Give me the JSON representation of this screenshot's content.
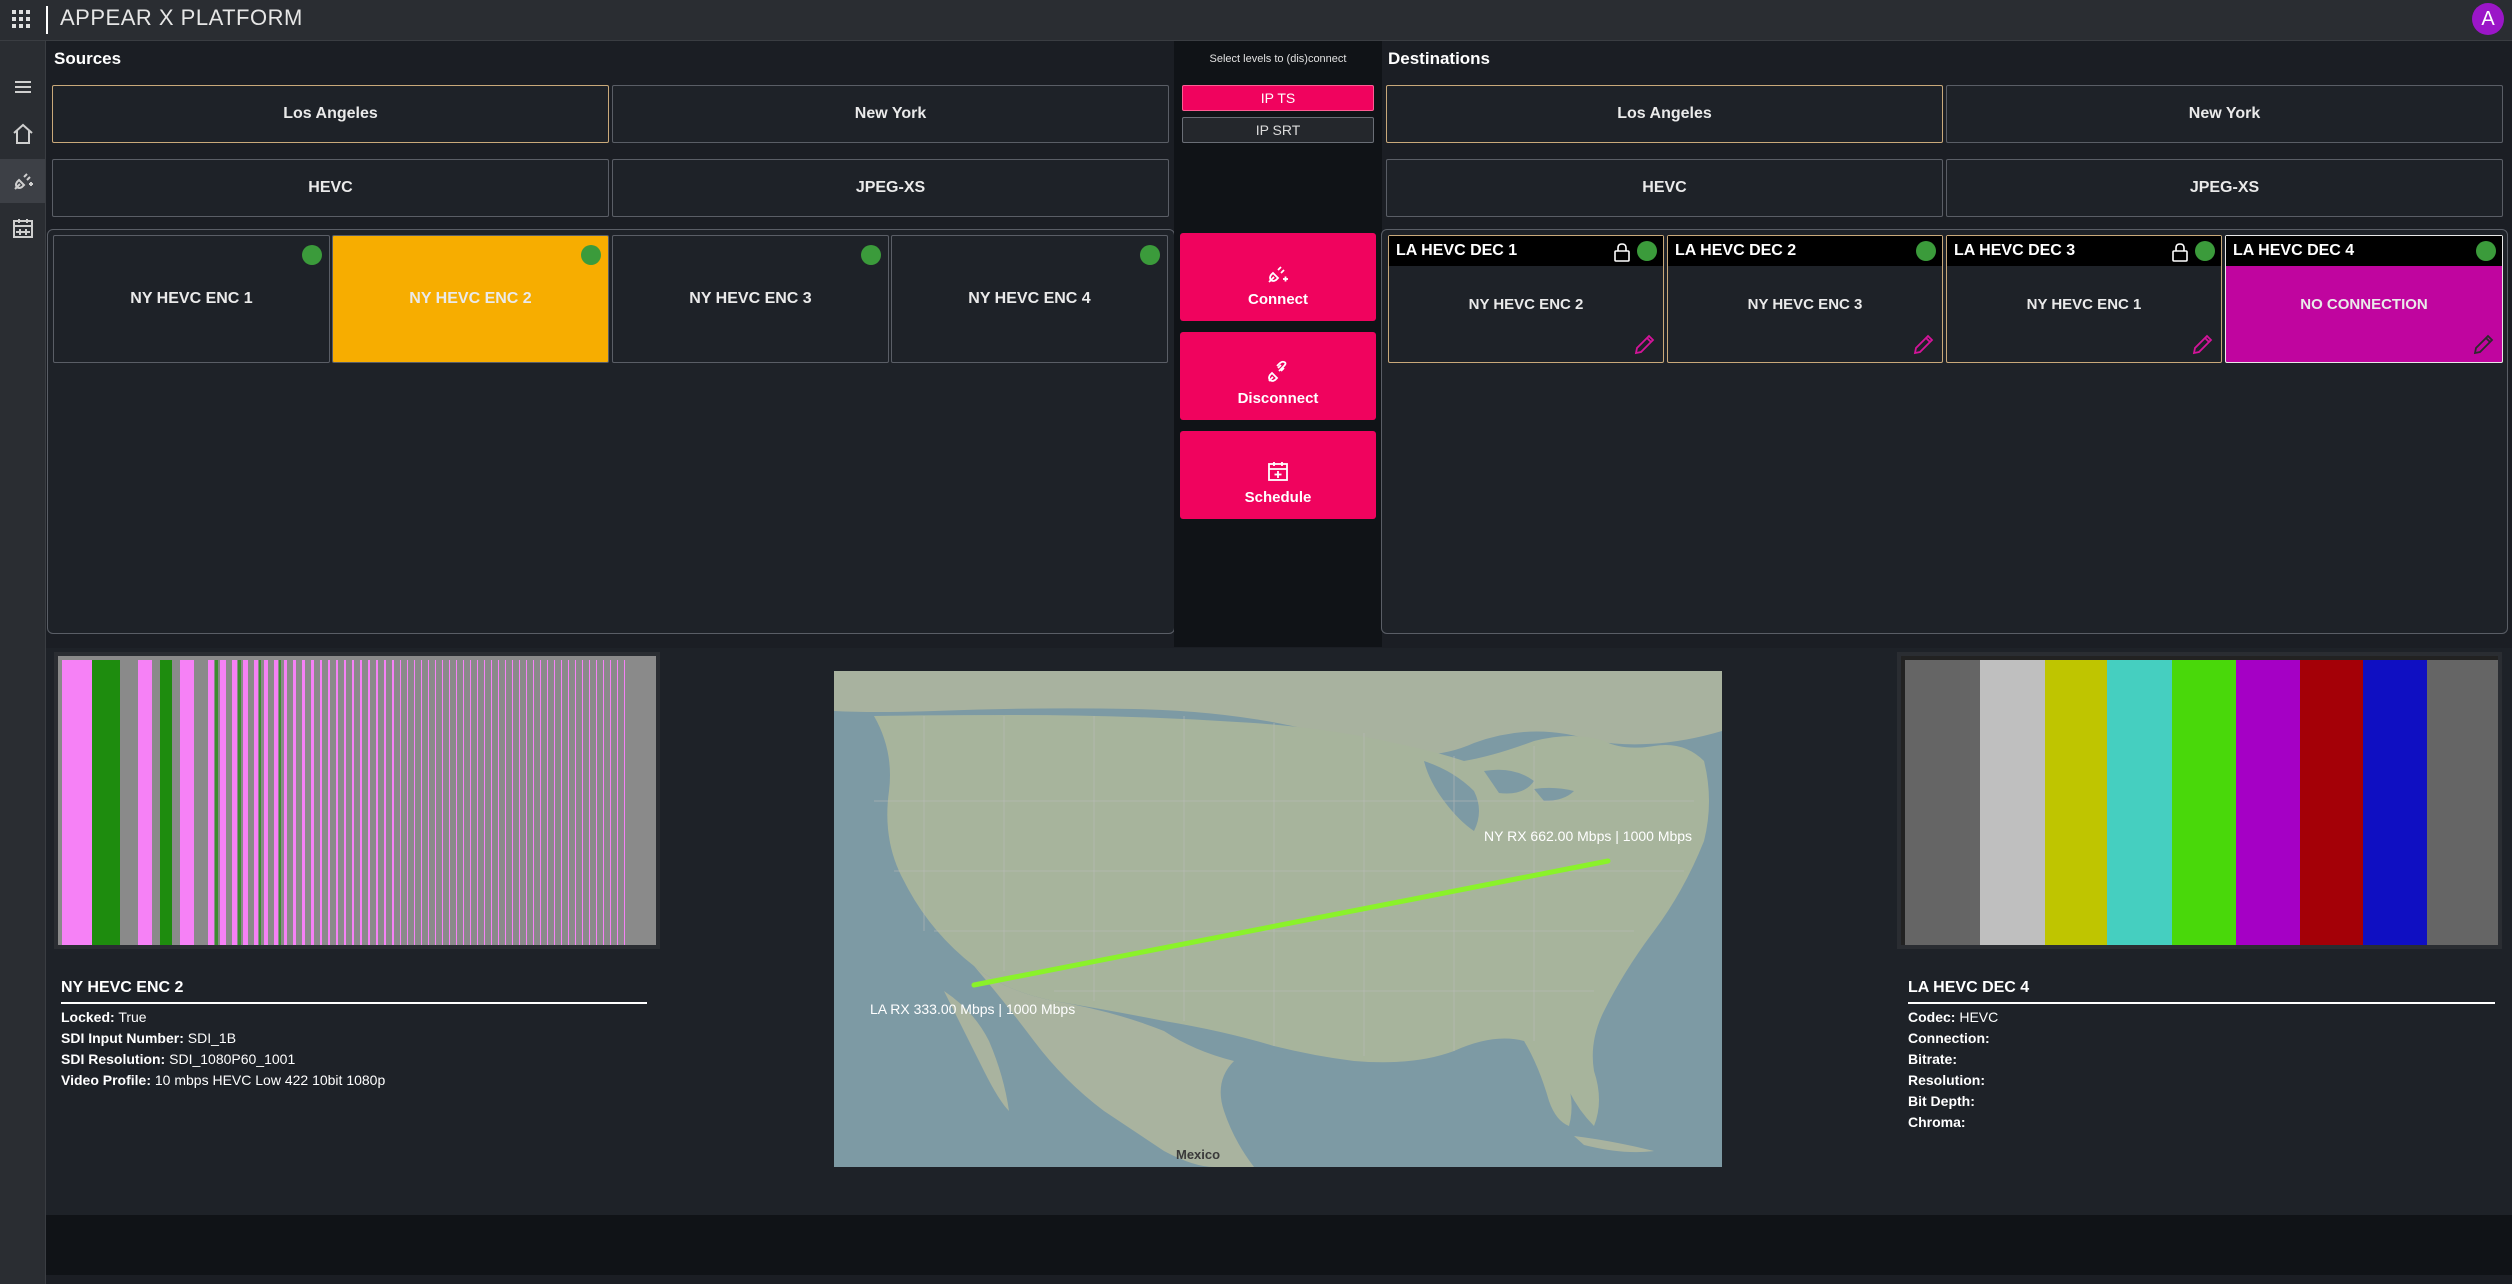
{
  "app": {
    "title": "APPEAR X PLATFORM",
    "avatar_letter": "A"
  },
  "sources": {
    "title": "Sources",
    "locations": [
      "Los Angeles",
      "New York"
    ],
    "codecs": [
      "HEVC",
      "JPEG-XS"
    ],
    "tiles": [
      "NY HEVC ENC 1",
      "NY HEVC ENC 2",
      "NY HEVC ENC 3",
      "NY HEVC ENC 4"
    ],
    "selected_tile": "NY HEVC ENC 2"
  },
  "middle": {
    "label": "Select levels to (dis)connect",
    "levels": [
      "IP TS",
      "IP SRT"
    ],
    "connect": "Connect",
    "disconnect": "Disconnect",
    "schedule": "Schedule"
  },
  "destinations": {
    "title": "Destinations",
    "locations": [
      "Los Angeles",
      "New York"
    ],
    "codecs": [
      "HEVC",
      "JPEG-XS"
    ],
    "tiles": [
      {
        "name": "LA HEVC DEC 1",
        "source": "NY HEVC ENC 2",
        "locked": true
      },
      {
        "name": "LA HEVC DEC 2",
        "source": "NY HEVC ENC 3",
        "locked": false
      },
      {
        "name": "LA HEVC DEC 3",
        "source": "NY HEVC ENC 1",
        "locked": true
      },
      {
        "name": "LA HEVC DEC 4",
        "source": "NO CONNECTION",
        "locked": false
      }
    ]
  },
  "source_info": {
    "title": "NY HEVC ENC 2",
    "rows": [
      {
        "label": "Locked:",
        "value": "True"
      },
      {
        "label": "SDI Input Number:",
        "value": "SDI_1B"
      },
      {
        "label": "SDI Resolution:",
        "value": "SDI_1080P60_1001"
      },
      {
        "label": "Video Profile:",
        "value": "10 mbps HEVC Low 422 10bit 1080p"
      }
    ]
  },
  "map": {
    "ny_label": "NY RX 662.00 Mbps | 1000 Mbps",
    "la_label": "LA RX 333.00 Mbps | 1000 Mbps",
    "mexico_label": "Mexico",
    "link_color": "#8af22a"
  },
  "dest_info": {
    "title": "LA HEVC DEC 4",
    "rows": [
      {
        "label": "Codec:",
        "value": "HEVC"
      },
      {
        "label": "Connection:",
        "value": ""
      },
      {
        "label": "Bitrate:",
        "value": ""
      },
      {
        "label": "Resolution:",
        "value": ""
      },
      {
        "label": "Bit Depth:",
        "value": ""
      },
      {
        "label": "Chroma:",
        "value": ""
      }
    ]
  },
  "colors": {
    "accent": "#f0035e",
    "selected_source": "#f7ad00",
    "no_connection": "#c0059f",
    "status_ok": "#3b9b3b",
    "color_bars": [
      "#656565",
      "#bfbfbf",
      "#bfc500",
      "#45cfc0",
      "#49d80a",
      "#a500c5",
      "#a40007",
      "#0f0fc2",
      "#656565"
    ]
  }
}
